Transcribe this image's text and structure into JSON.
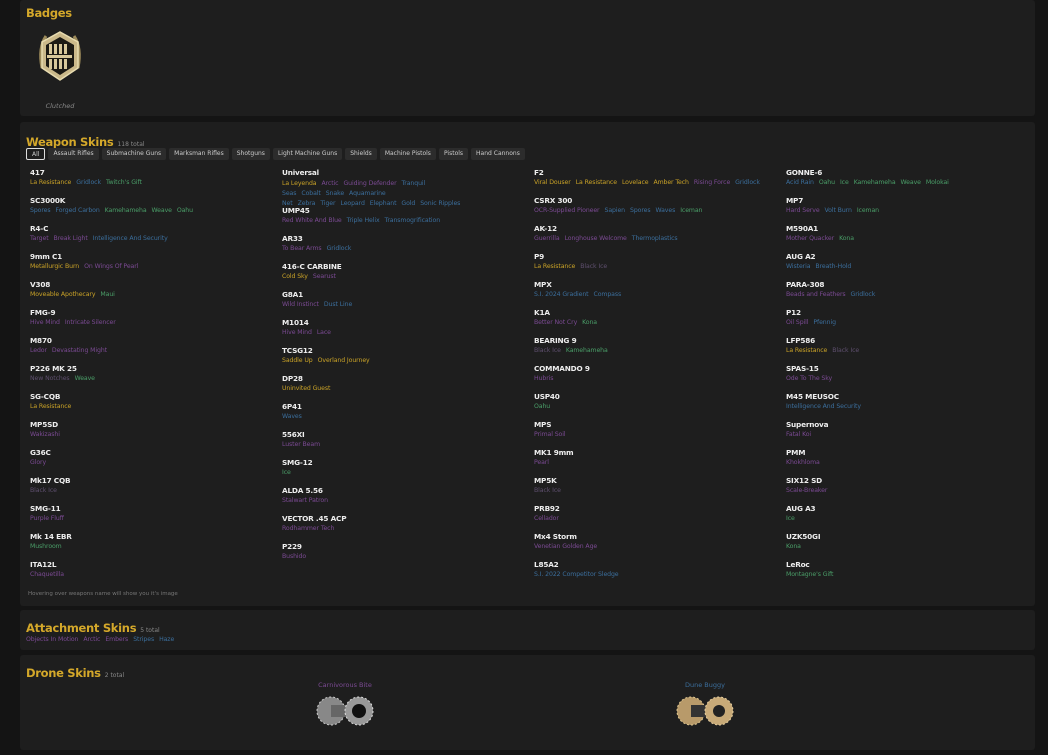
{
  "badges": {
    "title": "Badges",
    "items": [
      {
        "label": "Clutched"
      }
    ]
  },
  "weapon_skins": {
    "title": "Weapon Skins",
    "count": "118 total",
    "tabs": [
      "All",
      "Assault Rifles",
      "Submachine Guns",
      "Marksman Rifles",
      "Shotguns",
      "Light Machine Guns",
      "Shields",
      "Machine Pistols",
      "Pistols",
      "Hand Cannons"
    ],
    "active_tab": "All",
    "hint": "Hovering over weapons name will show you it's image",
    "rarity_colors": {
      "g": "#c9a227",
      "b": "#3b6e9c",
      "gr": "#4a9e68",
      "p": "#7b4a93",
      "k": "#5e4f6e"
    },
    "columns": [
      [
        {
          "name": "417",
          "skins": [
            [
              "La Resistance",
              "g"
            ],
            [
              "Gridlock",
              "b"
            ],
            [
              "Twitch's Gift",
              "gr"
            ]
          ]
        },
        {
          "name": "SC3000K",
          "skins": [
            [
              "Spores",
              "b"
            ],
            [
              "Forged Carbon",
              "b"
            ],
            [
              "Kamehameha",
              "gr"
            ],
            [
              "Weave",
              "gr"
            ],
            [
              "Oahu",
              "gr"
            ]
          ]
        },
        {
          "name": "R4-C",
          "skins": [
            [
              "Target",
              "p"
            ],
            [
              "Break Light",
              "p"
            ],
            [
              "Intelligence And Security",
              "b"
            ]
          ]
        },
        {
          "name": "9mm C1",
          "skins": [
            [
              "Metallurgic Burn",
              "g"
            ],
            [
              "On Wings Of Pearl",
              "p"
            ]
          ]
        },
        {
          "name": "V308",
          "skins": [
            [
              "Moveable Apothecary",
              "g"
            ],
            [
              "Maui",
              "gr"
            ]
          ]
        },
        {
          "name": "FMG-9",
          "skins": [
            [
              "Hive Mind",
              "p"
            ],
            [
              "Intricate Silencer",
              "p"
            ]
          ]
        },
        {
          "name": "M870",
          "skins": [
            [
              "Ledor",
              "p"
            ],
            [
              "Devastating Might",
              "p"
            ]
          ]
        },
        {
          "name": "P226 MK 25",
          "skins": [
            [
              "New Notches",
              "k"
            ],
            [
              "Weave",
              "gr"
            ]
          ]
        },
        {
          "name": "SG-CQB",
          "skins": [
            [
              "La Resistance",
              "g"
            ]
          ]
        },
        {
          "name": "MP5SD",
          "skins": [
            [
              "Wakizashi",
              "p"
            ]
          ]
        },
        {
          "name": "G36C",
          "skins": [
            [
              "Glory",
              "p"
            ]
          ]
        },
        {
          "name": "Mk17 CQB",
          "skins": [
            [
              "Black Ice",
              "k"
            ]
          ]
        },
        {
          "name": "SMG-11",
          "skins": [
            [
              "Purple Fluff",
              "p"
            ]
          ]
        },
        {
          "name": "Mk 14 EBR",
          "skins": [
            [
              "Mushroom",
              "gr"
            ]
          ]
        },
        {
          "name": "ITA12L",
          "skins": [
            [
              "Chaquetilla",
              "p"
            ]
          ]
        }
      ],
      [
        {
          "name": "Universal",
          "skins": [
            [
              "La Leyenda",
              "g"
            ],
            [
              "Arctic",
              "p"
            ],
            [
              "Guiding Defender",
              "p"
            ],
            [
              "Tranquil Seas",
              "b"
            ],
            [
              "Cobalt",
              "b"
            ],
            [
              "Snake",
              "b"
            ],
            [
              "Aquamarine Net",
              "b"
            ],
            [
              "Zebra",
              "b"
            ],
            [
              "Tiger",
              "b"
            ],
            [
              "Leopard",
              "b"
            ],
            [
              "Elephant",
              "b"
            ],
            [
              "Gold",
              "b"
            ],
            [
              "Sonic Ripples",
              "b"
            ]
          ]
        },
        {
          "name": "UMP45",
          "skins": [
            [
              "Red White And Blue",
              "p"
            ],
            [
              "Triple Helix",
              "b"
            ],
            [
              "Transmogrification",
              "b"
            ]
          ]
        },
        {
          "name": "AR33",
          "skins": [
            [
              "To Bear Arms",
              "p"
            ],
            [
              "Gridlock",
              "b"
            ]
          ]
        },
        {
          "name": "416-C CARBINE",
          "skins": [
            [
              "Cold Sky",
              "g"
            ],
            [
              "Searust",
              "p"
            ]
          ]
        },
        {
          "name": "G8A1",
          "skins": [
            [
              "Wild Instinct",
              "p"
            ],
            [
              "Dust Line",
              "b"
            ]
          ]
        },
        {
          "name": "M1014",
          "skins": [
            [
              "Hive Mind",
              "p"
            ],
            [
              "Lace",
              "p"
            ]
          ]
        },
        {
          "name": "TCSG12",
          "skins": [
            [
              "Saddle Up",
              "g"
            ],
            [
              "Overland Journey",
              "g"
            ]
          ]
        },
        {
          "name": "DP28",
          "skins": [
            [
              "Uninvited Guest",
              "g"
            ]
          ]
        },
        {
          "name": "6P41",
          "skins": [
            [
              "Waves",
              "b"
            ]
          ]
        },
        {
          "name": "556XI",
          "skins": [
            [
              "Luster Beam",
              "p"
            ]
          ]
        },
        {
          "name": "SMG-12",
          "skins": [
            [
              "Ice",
              "gr"
            ]
          ]
        },
        {
          "name": "ALDA 5.56",
          "skins": [
            [
              "Stalwart Patron",
              "p"
            ]
          ]
        },
        {
          "name": "VECTOR .45 ACP",
          "skins": [
            [
              "Rodhammer Tech",
              "p"
            ]
          ]
        },
        {
          "name": "P229",
          "skins": [
            [
              "Bushido",
              "p"
            ]
          ]
        }
      ],
      [
        {
          "name": "F2",
          "skins": [
            [
              "Viral Douser",
              "g"
            ],
            [
              "La Resistance",
              "g"
            ],
            [
              "Lovelace",
              "g"
            ],
            [
              "Amber Tech",
              "g"
            ],
            [
              "Rising Force",
              "p"
            ],
            [
              "Gridlock",
              "b"
            ]
          ]
        },
        {
          "name": "CSRX 300",
          "skins": [
            [
              "OCR-Supplied Pioneer",
              "p"
            ],
            [
              "Sapien",
              "b"
            ],
            [
              "Spores",
              "b"
            ],
            [
              "Waves",
              "b"
            ],
            [
              "Iceman",
              "gr"
            ]
          ]
        },
        {
          "name": "AK-12",
          "skins": [
            [
              "Guerrilla",
              "p"
            ],
            [
              "Longhouse Welcome",
              "p"
            ],
            [
              "Thermoplastics",
              "b"
            ]
          ]
        },
        {
          "name": "P9",
          "skins": [
            [
              "La Resistance",
              "g"
            ],
            [
              "Black Ice",
              "k"
            ]
          ]
        },
        {
          "name": "MPX",
          "skins": [
            [
              "S.I. 2024 Gradient",
              "b"
            ],
            [
              "Compass",
              "b"
            ]
          ]
        },
        {
          "name": "K1A",
          "skins": [
            [
              "Better Not Cry",
              "p"
            ],
            [
              "Kona",
              "gr"
            ]
          ]
        },
        {
          "name": "BEARING 9",
          "skins": [
            [
              "Black Ice",
              "k"
            ],
            [
              "Kamehameha",
              "gr"
            ]
          ]
        },
        {
          "name": "COMMANDO 9",
          "skins": [
            [
              "Hubris",
              "p"
            ]
          ]
        },
        {
          "name": "USP40",
          "skins": [
            [
              "Oahu",
              "gr"
            ]
          ]
        },
        {
          "name": "MPS",
          "skins": [
            [
              "Primal Soil",
              "p"
            ]
          ]
        },
        {
          "name": "MK1 9mm",
          "skins": [
            [
              "Pearl",
              "p"
            ]
          ]
        },
        {
          "name": "MP5K",
          "skins": [
            [
              "Black Ice",
              "k"
            ]
          ]
        },
        {
          "name": "PRB92",
          "skins": [
            [
              "Cellador",
              "p"
            ]
          ]
        },
        {
          "name": "Mx4 Storm",
          "skins": [
            [
              "Venetian Golden Age",
              "p"
            ]
          ]
        },
        {
          "name": "L85A2",
          "skins": [
            [
              "S.I. 2022 Competitor Sledge",
              "b"
            ]
          ]
        }
      ],
      [
        {
          "name": "GONNE-6",
          "skins": [
            [
              "Acid Rain",
              "b"
            ],
            [
              "Oahu",
              "gr"
            ],
            [
              "Ice",
              "gr"
            ],
            [
              "Kamehameha",
              "gr"
            ],
            [
              "Weave",
              "gr"
            ],
            [
              "Molokai",
              "gr"
            ]
          ]
        },
        {
          "name": "MP7",
          "skins": [
            [
              "Hard Serve",
              "p"
            ],
            [
              "Volt Burn",
              "b"
            ],
            [
              "Iceman",
              "gr"
            ]
          ]
        },
        {
          "name": "M590A1",
          "skins": [
            [
              "Mother Quacker",
              "p"
            ],
            [
              "Kona",
              "gr"
            ]
          ]
        },
        {
          "name": "AUG A2",
          "skins": [
            [
              "Wisteria",
              "b"
            ],
            [
              "Breath-Hold",
              "b"
            ]
          ]
        },
        {
          "name": "PARA-308",
          "skins": [
            [
              "Beads and Feathers",
              "p"
            ],
            [
              "Gridlock",
              "b"
            ]
          ]
        },
        {
          "name": "P12",
          "skins": [
            [
              "Oil Spill",
              "p"
            ],
            [
              "Pfennig",
              "b"
            ]
          ]
        },
        {
          "name": "LFP586",
          "skins": [
            [
              "La Resistance",
              "g"
            ],
            [
              "Black Ice",
              "k"
            ]
          ]
        },
        {
          "name": "SPAS-15",
          "skins": [
            [
              "Ode To The Sky",
              "p"
            ]
          ]
        },
        {
          "name": "M45 MEUSOC",
          "skins": [
            [
              "Intelligence And Security",
              "b"
            ]
          ]
        },
        {
          "name": "Supernova",
          "skins": [
            [
              "Fatal Koi",
              "p"
            ]
          ]
        },
        {
          "name": "PMM",
          "skins": [
            [
              "Khokhloma",
              "p"
            ]
          ]
        },
        {
          "name": "SIX12 SD",
          "skins": [
            [
              "Scale-Breaker",
              "p"
            ]
          ]
        },
        {
          "name": "AUG A3",
          "skins": [
            [
              "Ice",
              "gr"
            ]
          ]
        },
        {
          "name": "UZK50GI",
          "skins": [
            [
              "Kona",
              "gr"
            ]
          ]
        },
        {
          "name": "LeRoc",
          "skins": [
            [
              "Montagne's Gift",
              "gr"
            ]
          ]
        }
      ]
    ]
  },
  "attachment_skins": {
    "title": "Attachment Skins",
    "count": "5 total",
    "skins": [
      [
        "Objects In Motion",
        "p"
      ],
      [
        "Arctic",
        "p"
      ],
      [
        "Embers",
        "p"
      ],
      [
        "Stripes",
        "b"
      ],
      [
        "Haze",
        "b"
      ]
    ]
  },
  "drone_skins": {
    "title": "Drone Skins",
    "count": "2 total",
    "items": [
      {
        "label": "Carnivorous Bite",
        "rarity": "p"
      },
      {
        "label": "Dune Buggy",
        "rarity": "b"
      }
    ]
  }
}
